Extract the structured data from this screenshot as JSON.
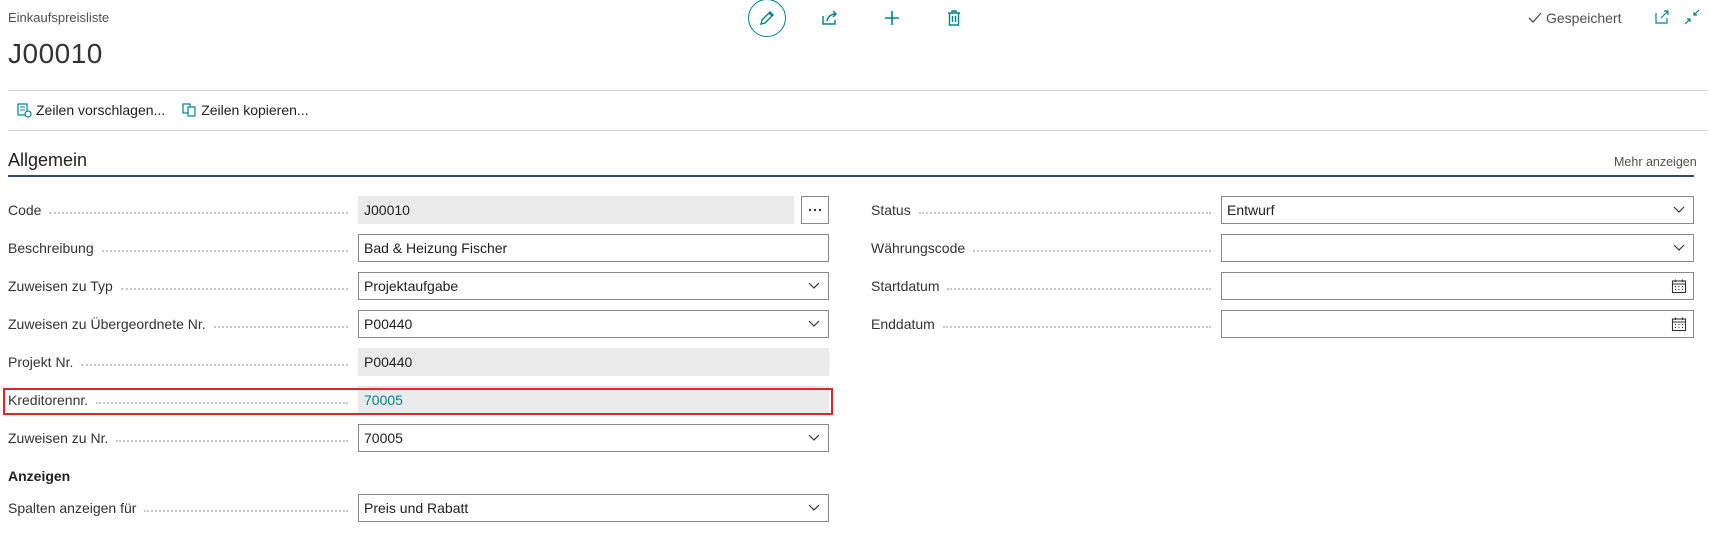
{
  "header": {
    "caption": "Einkaufspreisliste",
    "title": "J00010",
    "saved_label": "Gespeichert"
  },
  "actions": [
    {
      "label": "Zeilen vorschlagen..."
    },
    {
      "label": "Zeilen kopieren..."
    }
  ],
  "section": {
    "title": "Allgemein",
    "more_label": "Mehr anzeigen"
  },
  "left_fields": [
    {
      "label": "Code",
      "value": "J00010"
    },
    {
      "label": "Beschreibung",
      "value": "Bad & Heizung Fischer"
    },
    {
      "label": "Zuweisen zu Typ",
      "value": "Projektaufgabe"
    },
    {
      "label": "Zuweisen zu Übergeordnete Nr.",
      "value": "P00440"
    },
    {
      "label": "Projekt Nr.",
      "value": "P00440"
    },
    {
      "label": "Kreditorennr.",
      "value": "70005"
    },
    {
      "label": "Zuweisen zu Nr.",
      "value": "70005"
    }
  ],
  "right_fields": [
    {
      "label": "Status",
      "value": "Entwurf"
    },
    {
      "label": "Währungscode",
      "value": ""
    },
    {
      "label": "Startdatum",
      "value": ""
    },
    {
      "label": "Enddatum",
      "value": ""
    }
  ],
  "display": {
    "heading": "Anzeigen",
    "label": "Spalten anzeigen für",
    "value": "Preis und Rabatt"
  },
  "colors": {
    "accent": "#00838f",
    "section_underline": "#2f4a6b",
    "highlight": "#e0262d"
  }
}
